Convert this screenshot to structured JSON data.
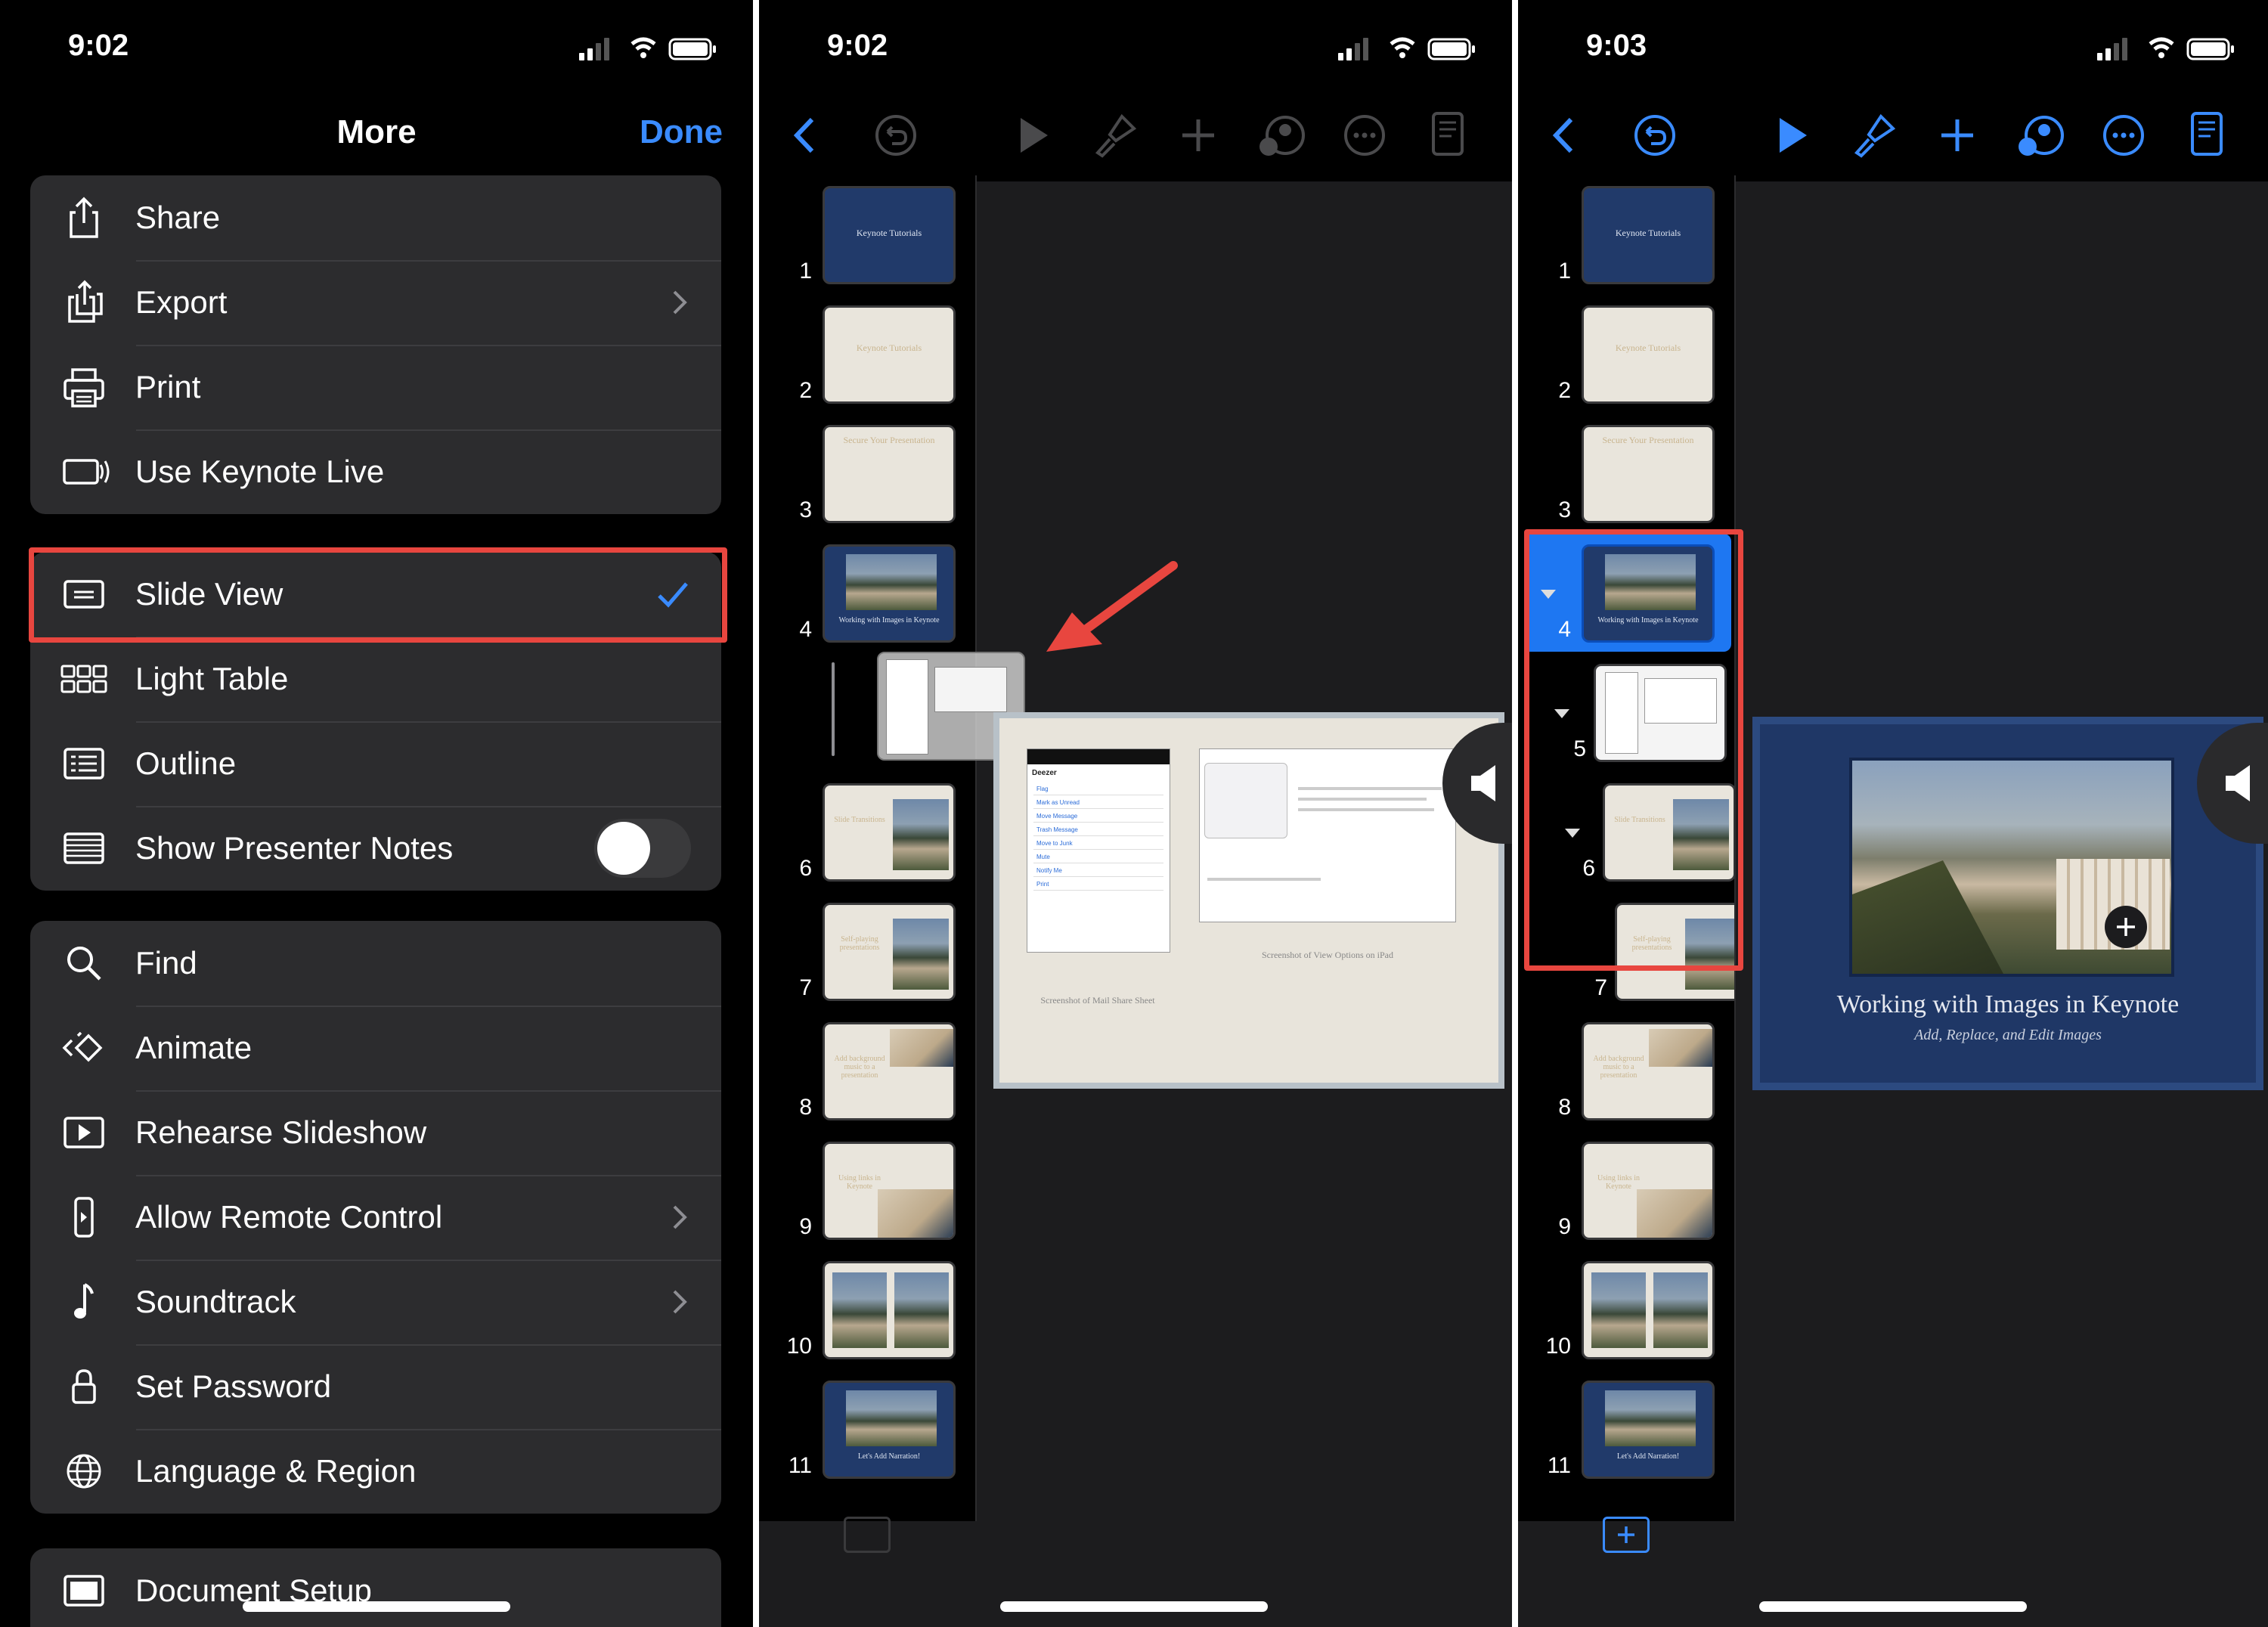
{
  "colors": {
    "accent": "#3a8bff",
    "highlight": "#e8463f",
    "selection": "#1e77f2"
  },
  "panel1": {
    "status_time": "9:02",
    "title": "More",
    "done_label": "Done",
    "group1": [
      {
        "label": "Share",
        "icon": "share-icon"
      },
      {
        "label": "Export",
        "icon": "export-icon",
        "chevron": true
      },
      {
        "label": "Print",
        "icon": "printer-icon"
      },
      {
        "label": "Use Keynote Live",
        "icon": "keynote-live-icon"
      }
    ],
    "group2": [
      {
        "label": "Slide View",
        "icon": "slide-view-icon",
        "checked": true
      },
      {
        "label": "Light Table",
        "icon": "light-table-icon"
      },
      {
        "label": "Outline",
        "icon": "outline-icon"
      },
      {
        "label": "Show Presenter Notes",
        "icon": "presenter-notes-icon",
        "toggle": false
      }
    ],
    "group3": [
      {
        "label": "Find",
        "icon": "magnifier-icon"
      },
      {
        "label": "Animate",
        "icon": "animate-icon"
      },
      {
        "label": "Rehearse Slideshow",
        "icon": "rehearse-icon"
      },
      {
        "label": "Allow Remote Control",
        "icon": "remote-icon",
        "chevron": true
      },
      {
        "label": "Soundtrack",
        "icon": "music-note-icon",
        "chevron": true
      },
      {
        "label": "Set Password",
        "icon": "lock-icon"
      },
      {
        "label": "Language & Region",
        "icon": "globe-icon"
      }
    ],
    "group4": [
      {
        "label": "Document Setup",
        "icon": "document-setup-icon"
      }
    ]
  },
  "panel2": {
    "status_time": "9:02",
    "slides": [
      {
        "num": "1",
        "title": "Keynote Tutorials",
        "style": "blue"
      },
      {
        "num": "2",
        "title": "Keynote Tutorials",
        "style": "cream"
      },
      {
        "num": "3",
        "title": "Secure Your Presentation",
        "style": "cream"
      },
      {
        "num": "4",
        "title": "Working with Images in Keynote",
        "style": "blue-photo"
      },
      {
        "num": "6",
        "title": "Slide Transitions",
        "style": "cream-photo"
      },
      {
        "num": "7",
        "title": "Self-playing presentations",
        "style": "cream-photo2"
      },
      {
        "num": "8",
        "title": "Add background music to a presentation",
        "style": "cream-sand"
      },
      {
        "num": "9",
        "title": "Using links in Keynote",
        "style": "cream-sand2"
      },
      {
        "num": "10",
        "title": "",
        "style": "cream-2photo"
      },
      {
        "num": "11",
        "title": "Let's Add Narration!",
        "style": "blue-photo"
      }
    ],
    "canvas": {
      "left_caption": "Screenshot of Mail Share Sheet",
      "right_caption": "Screenshot of View Options on iPad",
      "mail_header": "Deezer",
      "mail_items": [
        "Flag",
        "Mark as Unread",
        "Move Message",
        "Trash Message",
        "Move to Junk",
        "Mute",
        "Notify Me",
        "Print"
      ]
    }
  },
  "panel3": {
    "status_time": "9:03",
    "slides": [
      {
        "num": "1",
        "title": "Keynote Tutorials",
        "style": "blue"
      },
      {
        "num": "2",
        "title": "Keynote Tutorials",
        "style": "cream"
      },
      {
        "num": "3",
        "title": "Secure Your Presentation",
        "style": "cream"
      },
      {
        "num": "4",
        "title": "Working with Images in Keynote",
        "style": "blue-photo"
      },
      {
        "num": "5",
        "title": "",
        "style": "screenshot"
      },
      {
        "num": "6",
        "title": "Slide Transitions",
        "style": "cream-photo"
      },
      {
        "num": "7",
        "title": "Self-playing presentations",
        "style": "cream-photo2"
      },
      {
        "num": "8",
        "title": "Add background music to a presentation",
        "style": "cream-sand"
      },
      {
        "num": "9",
        "title": "Using links in Keynote",
        "style": "cream-sand2"
      },
      {
        "num": "10",
        "title": "",
        "style": "cream-2photo"
      },
      {
        "num": "11",
        "title": "Let's Add Narration!",
        "style": "blue-photo"
      }
    ],
    "main_slide": {
      "title": "Working with Images in Keynote",
      "subtitle": "Add, Replace, and Edit Images"
    }
  }
}
